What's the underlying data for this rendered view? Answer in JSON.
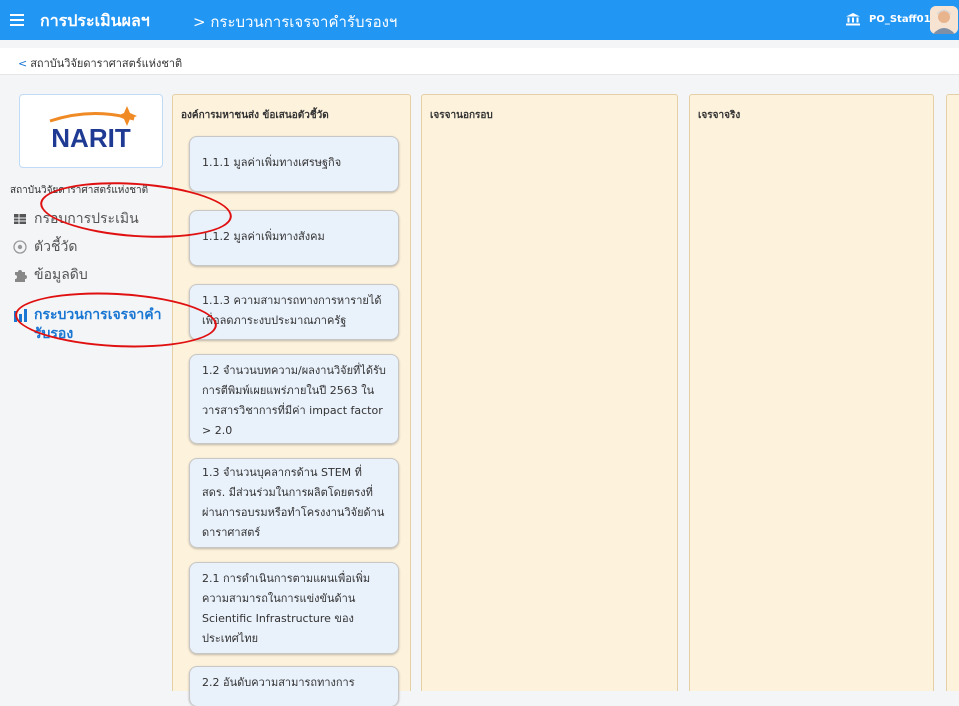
{
  "header": {
    "app_title": "การประเมินผลฯ",
    "breadcrumb": "> กระบวนการเจรจาคำรับรองฯ",
    "username": "PO_Staff01",
    "icons": {
      "menu": "hamburger-icon",
      "org": "bank-icon",
      "avatar": "user-avatar"
    },
    "accent": "#2196f3"
  },
  "back": {
    "label": "สถาบันวิจัยดาราศาสตร์แห่งชาติ"
  },
  "sidebar": {
    "logo_text": "NARIT",
    "org_name": "สถาบันวิจัยดาราศาสตร์แห่งชาติ",
    "items": [
      {
        "label": "กรอบการประเมิน",
        "icon": "table-icon"
      },
      {
        "label": "ตัวชี้วัด",
        "icon": "target-icon"
      },
      {
        "label": "ข้อมูลดิบ",
        "icon": "puzzle-icon"
      },
      {
        "label": "กระบวนการเจรจาคำรับรอง",
        "icon": "chart-bar-icon",
        "active": true
      }
    ]
  },
  "board": {
    "columns": [
      {
        "title": "องค์การมหาชนส่ง ข้อเสนอตัวชี้วัด"
      },
      {
        "title": "เจรจานอกรอบ"
      },
      {
        "title": "เจรจาจริง"
      },
      {
        "title": ""
      }
    ],
    "cards": [
      "1.1.1  มูลค่าเพิ่มทางเศรษฐกิจ",
      "1.1.2  มูลค่าเพิ่มทางสังคม",
      "1.1.3 ความสามารถทางการหารายได้ เพื่อลดภาระงบประมาณภาครัฐ",
      "1.2 จำนวนบทความ/ผลงานวิจัยที่ได้รับการตีพิมพ์เผยแพร่ภายในปี 2563 ในวารสารวิชาการที่มีค่า impact factor > 2.0",
      "1.3 จำนวนบุคลากรด้าน STEM ที่ สดร. มีส่วนร่วมในการผลิตโดยตรงที่ผ่านการอบรมหรือทำโครงงานวิจัยด้านดาราศาสตร์",
      "2.1 การดำเนินการตามแผนเพื่อเพิ่มความสามารถในการแข่งขันด้าน Scientific Infrastructure ของประเทศไทย",
      "2.2 อันดับความสามารถทางการ"
    ]
  },
  "annotation_color": "#e01010"
}
